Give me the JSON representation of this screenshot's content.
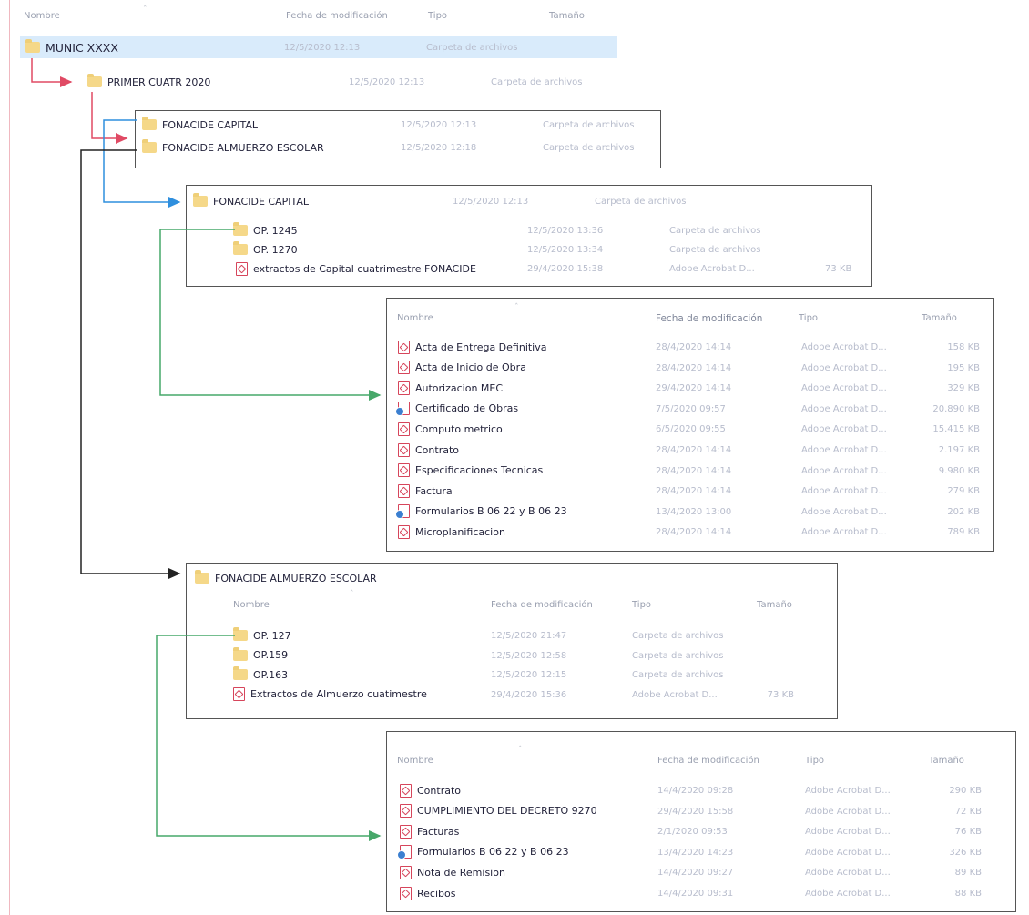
{
  "top_header": {
    "col_name": "Nombre",
    "col_date": "Fecha de modificación",
    "col_type": "Tipo",
    "col_size": "Tamaño"
  },
  "root": {
    "name": "MUNIC XXXX",
    "date": "12/5/2020 12:13",
    "type": "Carpeta de archivos"
  },
  "level1": {
    "name": "PRIMER CUATR 2020",
    "date": "12/5/2020 12:13",
    "type": "Carpeta de archivos"
  },
  "level2": [
    {
      "name": "FONACIDE CAPITAL",
      "date": "12/5/2020 12:13",
      "type": "Carpeta de archivos"
    },
    {
      "name": "FONACIDE ALMUERZO ESCOLAR",
      "date": "12/5/2020 12:18",
      "type": "Carpeta de archivos"
    }
  ],
  "capital": {
    "title": {
      "name": "FONACIDE CAPITAL",
      "date": "12/5/2020 12:13",
      "type": "Carpeta de archivos"
    },
    "items": [
      {
        "name": "OP. 1245",
        "date": "12/5/2020 13:36",
        "type": "Carpeta de archivos",
        "size": ""
      },
      {
        "name": "OP. 1270",
        "date": "12/5/2020 13:34",
        "type": "Carpeta de archivos",
        "size": ""
      },
      {
        "name": "extractos  de Capital cuatrimestre FONACIDE",
        "date": "29/4/2020 15:38",
        "type": "Adobe Acrobat D...",
        "size": "73 KB"
      }
    ]
  },
  "op1245": {
    "header": {
      "col_name": "Nombre",
      "col_date": "Fecha de modificación",
      "col_type": "Tipo",
      "col_size": "Tamaño"
    },
    "items": [
      {
        "name": "Acta de Entrega Definitiva",
        "date": "28/4/2020 14:14",
        "type": "Adobe Acrobat D...",
        "size": "158 KB"
      },
      {
        "name": "Acta de Inicio de Obra",
        "date": "28/4/2020 14:14",
        "type": "Adobe Acrobat D...",
        "size": "195 KB"
      },
      {
        "name": "Autorizacion MEC",
        "date": "29/4/2020 14:14",
        "type": "Adobe Acrobat D...",
        "size": "329 KB"
      },
      {
        "name": "Certificado de Obras",
        "date": "7/5/2020 09:57",
        "type": "Adobe Acrobat D...",
        "size": "20.890 KB"
      },
      {
        "name": "Computo metrico",
        "date": "6/5/2020 09:55",
        "type": "Adobe Acrobat D...",
        "size": "15.415 KB"
      },
      {
        "name": "Contrato",
        "date": "28/4/2020 14:14",
        "type": "Adobe Acrobat D...",
        "size": "2.197 KB"
      },
      {
        "name": "Especificaciones Tecnicas",
        "date": "28/4/2020 14:14",
        "type": "Adobe Acrobat D...",
        "size": "9.980 KB"
      },
      {
        "name": "Factura",
        "date": "28/4/2020 14:14",
        "type": "Adobe Acrobat D...",
        "size": "279 KB"
      },
      {
        "name": "Formularios B 06 22 y B 06 23",
        "date": "13/4/2020 13:00",
        "type": "Adobe Acrobat D...",
        "size": "202 KB"
      },
      {
        "name": "Microplanificacion",
        "date": "28/4/2020 14:14",
        "type": "Adobe Acrobat D...",
        "size": "789 KB"
      }
    ]
  },
  "almuerzo": {
    "title": {
      "name": "FONACIDE ALMUERZO ESCOLAR"
    },
    "header": {
      "col_name": "Nombre",
      "col_date": "Fecha de modificación",
      "col_type": "Tipo",
      "col_size": "Tamaño"
    },
    "items": [
      {
        "name": "OP. 127",
        "date": "12/5/2020 21:47",
        "type": "Carpeta de archivos",
        "size": ""
      },
      {
        "name": "OP.159",
        "date": "12/5/2020 12:58",
        "type": "Carpeta de archivos",
        "size": ""
      },
      {
        "name": "OP.163",
        "date": "12/5/2020 12:15",
        "type": "Carpeta de archivos",
        "size": ""
      },
      {
        "name": "Extractos de Almuerzo cuatimestre",
        "date": "29/4/2020 15:36",
        "type": "Adobe Acrobat D...",
        "size": "73 KB"
      }
    ]
  },
  "op127": {
    "header": {
      "col_name": "Nombre",
      "col_date": "Fecha de modificación",
      "col_type": "Tipo",
      "col_size": "Tamaño"
    },
    "items": [
      {
        "name": "Contrato",
        "date": "14/4/2020 09:28",
        "type": "Adobe Acrobat D...",
        "size": "290 KB",
        "icon": "pdf-icon"
      },
      {
        "name": "CUMPLIMIENTO DEL DECRETO 9270",
        "date": "29/4/2020 15:58",
        "type": "Adobe Acrobat D...",
        "size": "72 KB",
        "icon": "pdf-icon"
      },
      {
        "name": "Facturas",
        "date": "2/1/2020 09:53",
        "type": "Adobe Acrobat D...",
        "size": "76 KB",
        "icon": "pdf-icon"
      },
      {
        "name": "Formularios B 06 22 y B 06 23",
        "date": "13/4/2020 14:23",
        "type": "Adobe Acrobat D...",
        "size": "326 KB",
        "icon": "signed-pdf-icon"
      },
      {
        "name": "Nota de Remision",
        "date": "14/4/2020 09:27",
        "type": "Adobe Acrobat D...",
        "size": "89 KB",
        "icon": "pdf-icon"
      },
      {
        "name": "Recibos",
        "date": "14/4/2020 09:31",
        "type": "Adobe Acrobat D...",
        "size": "88 KB",
        "icon": "pdf-icon"
      }
    ]
  },
  "colors": {
    "red_arrow": "#e04a64",
    "blue_arrow": "#2f8fde",
    "green_arrow": "#47a86a",
    "black_arrow": "#222222",
    "selection": "#d9ebfb"
  }
}
